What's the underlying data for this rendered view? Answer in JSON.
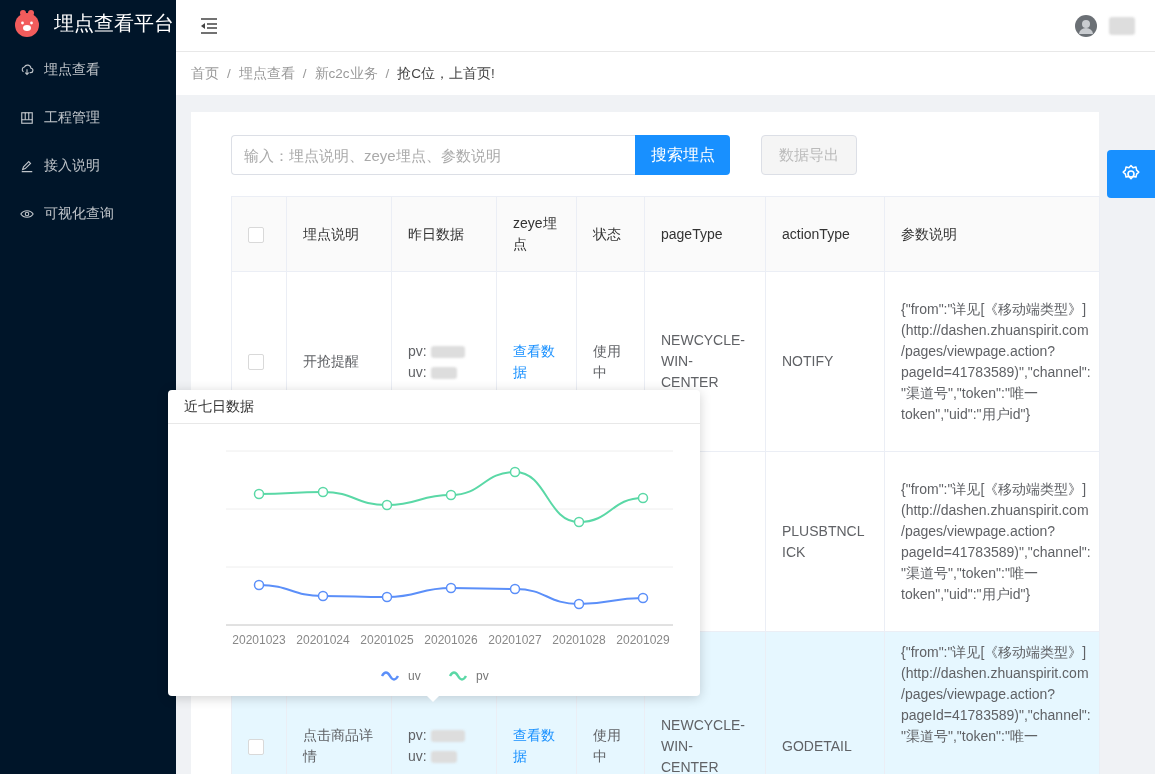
{
  "app": {
    "title": "埋点查看平台"
  },
  "sidebar": {
    "items": [
      {
        "label": "埋点查看",
        "selected": false
      },
      {
        "label": "工程管理",
        "selected": false
      },
      {
        "label": "接入说明",
        "selected": false
      },
      {
        "label": "可视化查询",
        "selected": false
      }
    ]
  },
  "breadcrumb": [
    {
      "label": "首页",
      "separator": "/"
    },
    {
      "label": "埋点查看",
      "separator": "/"
    },
    {
      "label": "新c2c业务",
      "separator": "/"
    },
    {
      "label": "抢C位，上首页!"
    }
  ],
  "search": {
    "placeholder": "输入：埋点说明、zeye埋点、参数说明",
    "button": "搜索埋点",
    "export_button": "数据导出",
    "export_disabled": true
  },
  "table": {
    "select_all_checked": false,
    "columns": [
      "埋点说明",
      "昨日数据",
      "zeye埋点",
      "状态",
      "pageType",
      "actionType",
      "参数说明"
    ],
    "rows": [
      {
        "checked": false,
        "highlighted": false,
        "description": "开抢提醒",
        "pv_label": "pv:",
        "uv_label": "uv:",
        "zeye": "查看数据",
        "status": "使用中",
        "page_type": "NEWCYCLE-WIN-CENTER",
        "action_type": "NOTIFY",
        "params": "{\"from\":\"详见[《移动端类型》](http://dashen.zhuanspirit.com/pages/viewpage.action?pageId=41783589)\",\"channel\":\"渠道号\",\"token\":\"唯一token\",\"uid\":\"用户id\"}"
      },
      {
        "highlighted": false,
        "action_type": "PLUSBTNCLICK",
        "params": "{\"from\":\"详见[《移动端类型》](http://dashen.zhuanspirit.com/pages/viewpage.action?pageId=41783589)\",\"channel\":\"渠道号\",\"token\":\"唯一token\",\"uid\":\"用户id\"}"
      },
      {
        "checked": false,
        "highlighted": true,
        "description": "点击商品详情",
        "pv_label": "pv:",
        "uv_label": "uv:",
        "zeye": "查看数据",
        "status": "使用中",
        "page_type": "NEWCYCLE-WIN-CENTER",
        "action_type": "GODETAIL",
        "params": "{\"from\":\"详见[《移动端类型》](http://dashen.zhuanspirit.com/pages/viewpage.action?pageId=41783589)\",\"channel\":\"渠道号\",\"token\":\"唯一"
      }
    ]
  },
  "popover": {
    "title": "近七日数据",
    "x_labels": [
      "20201023",
      "20201024",
      "20201025",
      "20201026",
      "20201027",
      "20201028",
      "20201029"
    ],
    "series": [
      {
        "name": "uv",
        "color": "#5b8ff9"
      },
      {
        "name": "pv",
        "color": "#5ad8a6"
      }
    ]
  }
}
